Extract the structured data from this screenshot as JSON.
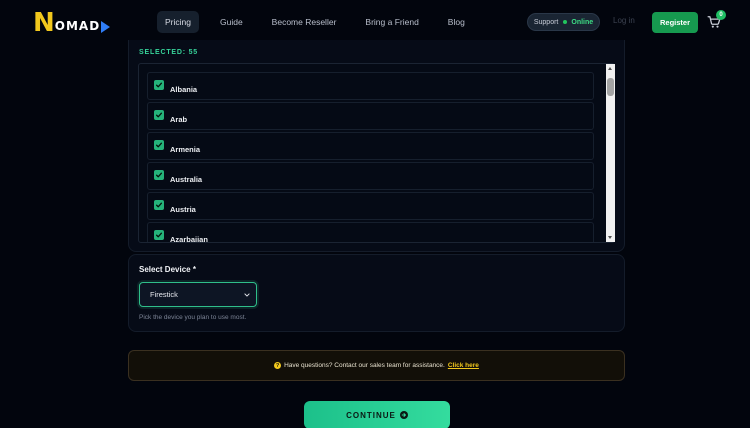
{
  "header": {
    "logo": {
      "first": "N",
      "rest": "OMAD"
    },
    "nav": [
      {
        "label": "Pricing",
        "active": true
      },
      {
        "label": "Guide"
      },
      {
        "label": "Become Reseller"
      },
      {
        "label": "Bring a Friend"
      },
      {
        "label": "Blog"
      }
    ],
    "support": {
      "label": "Support",
      "status": "Online"
    },
    "login": "Log in",
    "register": "Register",
    "cart_count": "0"
  },
  "countries": {
    "selected_label": "SELECTED: 55",
    "items": [
      "Albania",
      "Arab",
      "Armenia",
      "Australia",
      "Austria",
      "Azarbaijan"
    ]
  },
  "device": {
    "label": "Select Device *",
    "selected": "Firestick",
    "hint": "Pick the device you plan to use most."
  },
  "banner": {
    "text": "Have questions? Contact our sales team for assistance.",
    "link": "Click here"
  },
  "continue_label": "CONTINUE",
  "colors": {
    "accent": "#2fbf8a",
    "brand_yellow": "#f2c81d",
    "background": "#02050d"
  }
}
